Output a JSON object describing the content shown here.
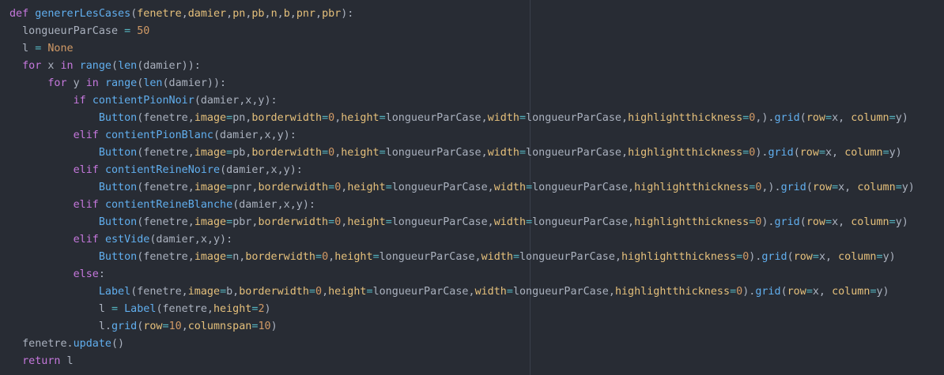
{
  "editor": {
    "colors": {
      "background": "#282c34",
      "keyword": "#c678dd",
      "function": "#61afef",
      "parameter": "#e5c07b",
      "number": "#d19a66",
      "operator": "#56b6c2",
      "text": "#abb2bf",
      "ruler": "#3a3f4b"
    },
    "lines": [
      [
        [
          "kw",
          "def"
        ],
        [
          "pl",
          " "
        ],
        [
          "fn",
          "genererLesCases"
        ],
        [
          "pl",
          "("
        ],
        [
          "p",
          "fenetre"
        ],
        [
          "pl",
          ","
        ],
        [
          "p",
          "damier"
        ],
        [
          "pl",
          ","
        ],
        [
          "p",
          "pn"
        ],
        [
          "pl",
          ","
        ],
        [
          "p",
          "pb"
        ],
        [
          "pl",
          ","
        ],
        [
          "p",
          "n"
        ],
        [
          "pl",
          ","
        ],
        [
          "p",
          "b"
        ],
        [
          "pl",
          ","
        ],
        [
          "p",
          "pnr"
        ],
        [
          "pl",
          ","
        ],
        [
          "p",
          "pbr"
        ],
        [
          "pl",
          "):"
        ]
      ],
      [
        [
          "pl",
          "  longueurParCase "
        ],
        [
          "op",
          "="
        ],
        [
          "pl",
          " "
        ],
        [
          "num",
          "50"
        ]
      ],
      [
        [
          "pl",
          "  l "
        ],
        [
          "op",
          "="
        ],
        [
          "pl",
          " "
        ],
        [
          "const",
          "None"
        ]
      ],
      [
        [
          "pl",
          "  "
        ],
        [
          "kw",
          "for"
        ],
        [
          "pl",
          " x "
        ],
        [
          "kw",
          "in"
        ],
        [
          "pl",
          " "
        ],
        [
          "fn",
          "range"
        ],
        [
          "pl",
          "("
        ],
        [
          "fn",
          "len"
        ],
        [
          "pl",
          "(damier)):"
        ]
      ],
      [
        [
          "pl",
          "      "
        ],
        [
          "kw",
          "for"
        ],
        [
          "pl",
          " y "
        ],
        [
          "kw",
          "in"
        ],
        [
          "pl",
          " "
        ],
        [
          "fn",
          "range"
        ],
        [
          "pl",
          "("
        ],
        [
          "fn",
          "len"
        ],
        [
          "pl",
          "(damier)):"
        ]
      ],
      [
        [
          "pl",
          "          "
        ],
        [
          "kw",
          "if"
        ],
        [
          "pl",
          " "
        ],
        [
          "fn",
          "contientPionNoir"
        ],
        [
          "pl",
          "(damier,x,y):"
        ]
      ],
      [
        [
          "pl",
          "              "
        ],
        [
          "fn",
          "Button"
        ],
        [
          "pl",
          "(fenetre,"
        ],
        [
          "kwarg",
          "image"
        ],
        [
          "op",
          "="
        ],
        [
          "pl",
          "pn,"
        ],
        [
          "kwarg",
          "borderwidth"
        ],
        [
          "op",
          "="
        ],
        [
          "num",
          "0"
        ],
        [
          "pl",
          ","
        ],
        [
          "kwarg",
          "height"
        ],
        [
          "op",
          "="
        ],
        [
          "pl",
          "longueurParCase,"
        ],
        [
          "kwarg",
          "width"
        ],
        [
          "op",
          "="
        ],
        [
          "pl",
          "longueurParCase,"
        ],
        [
          "kwarg",
          "highlightthickness"
        ],
        [
          "op",
          "="
        ],
        [
          "num",
          "0"
        ],
        [
          "pl",
          ",)."
        ],
        [
          "fn",
          "grid"
        ],
        [
          "pl",
          "("
        ],
        [
          "kwarg",
          "row"
        ],
        [
          "op",
          "="
        ],
        [
          "pl",
          "x, "
        ],
        [
          "kwarg",
          "column"
        ],
        [
          "op",
          "="
        ],
        [
          "pl",
          "y)"
        ]
      ],
      [
        [
          "pl",
          "          "
        ],
        [
          "kw",
          "elif"
        ],
        [
          "pl",
          " "
        ],
        [
          "fn",
          "contientPionBlanc"
        ],
        [
          "pl",
          "(damier,x,y):"
        ]
      ],
      [
        [
          "pl",
          "              "
        ],
        [
          "fn",
          "Button"
        ],
        [
          "pl",
          "(fenetre,"
        ],
        [
          "kwarg",
          "image"
        ],
        [
          "op",
          "="
        ],
        [
          "pl",
          "pb,"
        ],
        [
          "kwarg",
          "borderwidth"
        ],
        [
          "op",
          "="
        ],
        [
          "num",
          "0"
        ],
        [
          "pl",
          ","
        ],
        [
          "kwarg",
          "height"
        ],
        [
          "op",
          "="
        ],
        [
          "pl",
          "longueurParCase,"
        ],
        [
          "kwarg",
          "width"
        ],
        [
          "op",
          "="
        ],
        [
          "pl",
          "longueurParCase,"
        ],
        [
          "kwarg",
          "highlightthickness"
        ],
        [
          "op",
          "="
        ],
        [
          "num",
          "0"
        ],
        [
          "pl",
          ")."
        ],
        [
          "fn",
          "grid"
        ],
        [
          "pl",
          "("
        ],
        [
          "kwarg",
          "row"
        ],
        [
          "op",
          "="
        ],
        [
          "pl",
          "x, "
        ],
        [
          "kwarg",
          "column"
        ],
        [
          "op",
          "="
        ],
        [
          "pl",
          "y)"
        ]
      ],
      [
        [
          "pl",
          "          "
        ],
        [
          "kw",
          "elif"
        ],
        [
          "pl",
          " "
        ],
        [
          "fn",
          "contientReineNoire"
        ],
        [
          "pl",
          "(damier,x,y):"
        ]
      ],
      [
        [
          "pl",
          "              "
        ],
        [
          "fn",
          "Button"
        ],
        [
          "pl",
          "(fenetre,"
        ],
        [
          "kwarg",
          "image"
        ],
        [
          "op",
          "="
        ],
        [
          "pl",
          "pnr,"
        ],
        [
          "kwarg",
          "borderwidth"
        ],
        [
          "op",
          "="
        ],
        [
          "num",
          "0"
        ],
        [
          "pl",
          ","
        ],
        [
          "kwarg",
          "height"
        ],
        [
          "op",
          "="
        ],
        [
          "pl",
          "longueurParCase,"
        ],
        [
          "kwarg",
          "width"
        ],
        [
          "op",
          "="
        ],
        [
          "pl",
          "longueurParCase,"
        ],
        [
          "kwarg",
          "highlightthickness"
        ],
        [
          "op",
          "="
        ],
        [
          "num",
          "0"
        ],
        [
          "pl",
          ",)."
        ],
        [
          "fn",
          "grid"
        ],
        [
          "pl",
          "("
        ],
        [
          "kwarg",
          "row"
        ],
        [
          "op",
          "="
        ],
        [
          "pl",
          "x, "
        ],
        [
          "kwarg",
          "column"
        ],
        [
          "op",
          "="
        ],
        [
          "pl",
          "y)"
        ]
      ],
      [
        [
          "pl",
          "          "
        ],
        [
          "kw",
          "elif"
        ],
        [
          "pl",
          " "
        ],
        [
          "fn",
          "contientReineBlanche"
        ],
        [
          "pl",
          "(damier,x,y):"
        ]
      ],
      [
        [
          "pl",
          "              "
        ],
        [
          "fn",
          "Button"
        ],
        [
          "pl",
          "(fenetre,"
        ],
        [
          "kwarg",
          "image"
        ],
        [
          "op",
          "="
        ],
        [
          "pl",
          "pbr,"
        ],
        [
          "kwarg",
          "borderwidth"
        ],
        [
          "op",
          "="
        ],
        [
          "num",
          "0"
        ],
        [
          "pl",
          ","
        ],
        [
          "kwarg",
          "height"
        ],
        [
          "op",
          "="
        ],
        [
          "pl",
          "longueurParCase,"
        ],
        [
          "kwarg",
          "width"
        ],
        [
          "op",
          "="
        ],
        [
          "pl",
          "longueurParCase,"
        ],
        [
          "kwarg",
          "highlightthickness"
        ],
        [
          "op",
          "="
        ],
        [
          "num",
          "0"
        ],
        [
          "pl",
          ")."
        ],
        [
          "fn",
          "grid"
        ],
        [
          "pl",
          "("
        ],
        [
          "kwarg",
          "row"
        ],
        [
          "op",
          "="
        ],
        [
          "pl",
          "x, "
        ],
        [
          "kwarg",
          "column"
        ],
        [
          "op",
          "="
        ],
        [
          "pl",
          "y)"
        ]
      ],
      [
        [
          "pl",
          "          "
        ],
        [
          "kw",
          "elif"
        ],
        [
          "pl",
          " "
        ],
        [
          "fn",
          "estVide"
        ],
        [
          "pl",
          "(damier,x,y):"
        ]
      ],
      [
        [
          "pl",
          "              "
        ],
        [
          "fn",
          "Button"
        ],
        [
          "pl",
          "(fenetre,"
        ],
        [
          "kwarg",
          "image"
        ],
        [
          "op",
          "="
        ],
        [
          "pl",
          "n,"
        ],
        [
          "kwarg",
          "borderwidth"
        ],
        [
          "op",
          "="
        ],
        [
          "num",
          "0"
        ],
        [
          "pl",
          ","
        ],
        [
          "kwarg",
          "height"
        ],
        [
          "op",
          "="
        ],
        [
          "pl",
          "longueurParCase,"
        ],
        [
          "kwarg",
          "width"
        ],
        [
          "op",
          "="
        ],
        [
          "pl",
          "longueurParCase,"
        ],
        [
          "kwarg",
          "highlightthickness"
        ],
        [
          "op",
          "="
        ],
        [
          "num",
          "0"
        ],
        [
          "pl",
          ")."
        ],
        [
          "fn",
          "grid"
        ],
        [
          "pl",
          "("
        ],
        [
          "kwarg",
          "row"
        ],
        [
          "op",
          "="
        ],
        [
          "pl",
          "x, "
        ],
        [
          "kwarg",
          "column"
        ],
        [
          "op",
          "="
        ],
        [
          "pl",
          "y)"
        ]
      ],
      [
        [
          "pl",
          "          "
        ],
        [
          "kw",
          "else"
        ],
        [
          "pl",
          ":"
        ]
      ],
      [
        [
          "pl",
          "              "
        ],
        [
          "fn",
          "Label"
        ],
        [
          "pl",
          "(fenetre,"
        ],
        [
          "kwarg",
          "image"
        ],
        [
          "op",
          "="
        ],
        [
          "pl",
          "b,"
        ],
        [
          "kwarg",
          "borderwidth"
        ],
        [
          "op",
          "="
        ],
        [
          "num",
          "0"
        ],
        [
          "pl",
          ","
        ],
        [
          "kwarg",
          "height"
        ],
        [
          "op",
          "="
        ],
        [
          "pl",
          "longueurParCase,"
        ],
        [
          "kwarg",
          "width"
        ],
        [
          "op",
          "="
        ],
        [
          "pl",
          "longueurParCase,"
        ],
        [
          "kwarg",
          "highlightthickness"
        ],
        [
          "op",
          "="
        ],
        [
          "num",
          "0"
        ],
        [
          "pl",
          ")."
        ],
        [
          "fn",
          "grid"
        ],
        [
          "pl",
          "("
        ],
        [
          "kwarg",
          "row"
        ],
        [
          "op",
          "="
        ],
        [
          "pl",
          "x, "
        ],
        [
          "kwarg",
          "column"
        ],
        [
          "op",
          "="
        ],
        [
          "pl",
          "y)"
        ]
      ],
      [
        [
          "pl",
          "              l "
        ],
        [
          "op",
          "="
        ],
        [
          "pl",
          " "
        ],
        [
          "fn",
          "Label"
        ],
        [
          "pl",
          "(fenetre,"
        ],
        [
          "kwarg",
          "height"
        ],
        [
          "op",
          "="
        ],
        [
          "num",
          "2"
        ],
        [
          "pl",
          ")"
        ]
      ],
      [
        [
          "pl",
          "              l."
        ],
        [
          "fn",
          "grid"
        ],
        [
          "pl",
          "("
        ],
        [
          "kwarg",
          "row"
        ],
        [
          "op",
          "="
        ],
        [
          "num",
          "10"
        ],
        [
          "pl",
          ","
        ],
        [
          "kwarg",
          "columnspan"
        ],
        [
          "op",
          "="
        ],
        [
          "num",
          "10"
        ],
        [
          "pl",
          ")"
        ]
      ],
      [
        [
          "pl",
          "  fenetre."
        ],
        [
          "fn",
          "update"
        ],
        [
          "pl",
          "()"
        ]
      ],
      [
        [
          "pl",
          "  "
        ],
        [
          "kw",
          "return"
        ],
        [
          "pl",
          " l"
        ]
      ]
    ]
  }
}
